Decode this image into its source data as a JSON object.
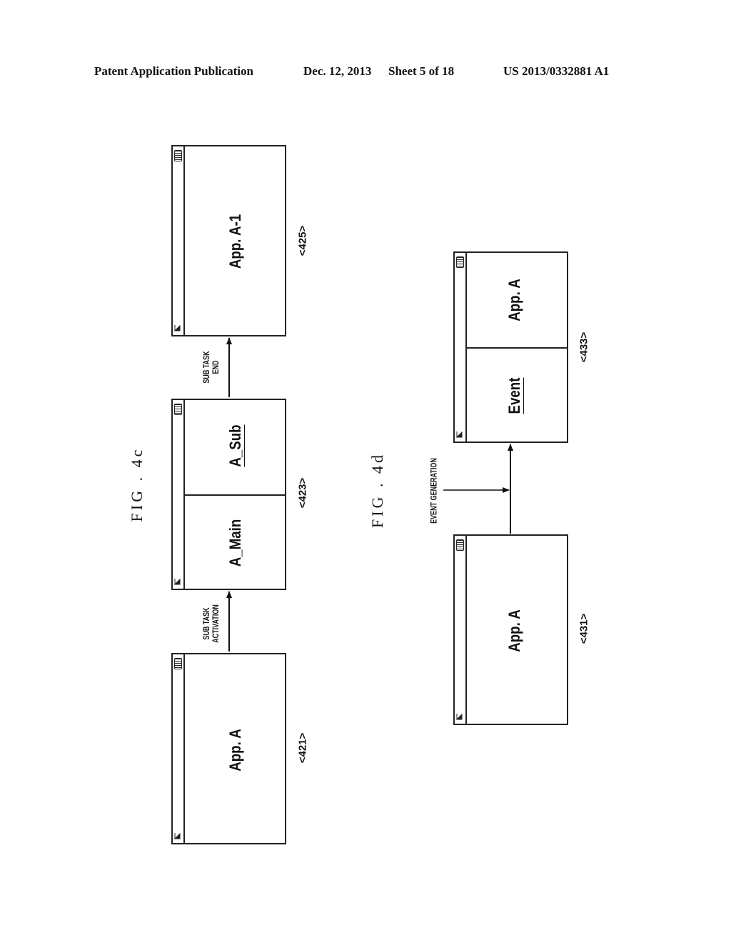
{
  "header": {
    "publication_type": "Patent Application Publication",
    "date": "Dec. 12, 2013",
    "sheet": "Sheet 5 of 18",
    "patent_number": "US 2013/0332881 A1"
  },
  "figures": [
    {
      "caption": "FIG . 4c",
      "screens": [
        {
          "ref": "<421>",
          "panes": [
            "App. A"
          ]
        },
        {
          "ref": "<423>",
          "panes": [
            "A_Main",
            "A_Sub"
          ],
          "underlined_pane": "A_Sub"
        },
        {
          "ref": "<425>",
          "panes": [
            "App. A-1"
          ]
        }
      ],
      "transitions": [
        {
          "from": "<421>",
          "to": "<423>",
          "label_line1": "SUB TASK",
          "label_line2": "ACTIVATION"
        },
        {
          "from": "<423>",
          "to": "<425>",
          "label_line1": "SUB TASK",
          "label_line2": "END"
        }
      ]
    },
    {
      "caption": "FIG . 4d",
      "screens": [
        {
          "ref": "<431>",
          "panes": [
            "App. A"
          ]
        },
        {
          "ref": "<433>",
          "panes": [
            "Event",
            "App. A"
          ],
          "underlined_pane": "Event"
        }
      ],
      "transitions": [
        {
          "from": "<431>",
          "to": "<433>",
          "label": "EVENT GENERATION"
        }
      ]
    }
  ],
  "icons": {
    "status_left": "signal-icon",
    "status_right": "battery-icon"
  }
}
